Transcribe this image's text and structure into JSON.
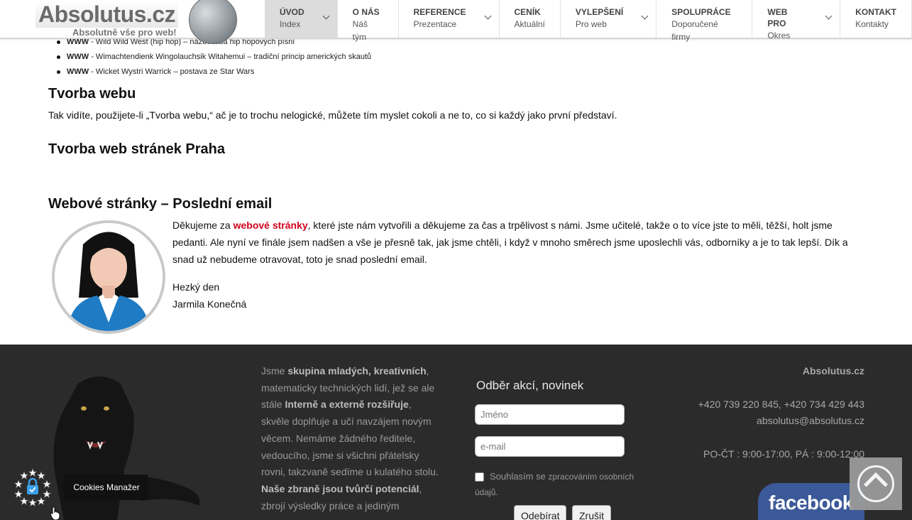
{
  "logo": {
    "name": "Absolutus.cz",
    "tagline": "Absolutně vše pro web!"
  },
  "nav": [
    {
      "title": "ÚVOD",
      "sub": "Index",
      "active": true,
      "dropdown": true
    },
    {
      "title": "O NÁS",
      "sub": "Náš tým",
      "active": false,
      "dropdown": false
    },
    {
      "title": "REFERENCE",
      "sub": "Prezentace",
      "active": false,
      "dropdown": true
    },
    {
      "title": "CENÍK",
      "sub": "Aktuální",
      "active": false,
      "dropdown": false
    },
    {
      "title": "VYLEPŠENÍ",
      "sub": "Pro web",
      "active": false,
      "dropdown": true
    },
    {
      "title": "SPOLUPRÁCE",
      "sub": "Doporučené firmy",
      "active": false,
      "dropdown": false
    },
    {
      "title": "WEB PRO",
      "sub": "Okres",
      "active": false,
      "dropdown": true
    },
    {
      "title": "KONTAKT",
      "sub": "Kontakty",
      "active": false,
      "dropdown": false
    }
  ],
  "bullets": [
    {
      "strong": "WWW",
      "text": " - Wild Wild West (hip hop) – název alba hip hopových písní"
    },
    {
      "strong": "WWW",
      "text": " - Wimachtendienk Wingolauchsik Witahemui – tradiční princip amerických skautů"
    },
    {
      "strong": "WWW",
      "text": " - Wicket Wystri Warrick – postava ze Star Wars"
    }
  ],
  "sections": {
    "tvorba_webu_heading": "Tvorba webu",
    "tvorba_webu_text": "Tak vidíte, použijete-li „Tvorba webu,“ ač je to trochu nelogické, můžete tím myslet cokoli a ne to, co si každý jako první představí.",
    "praha_heading": "Tvorba web stránek Praha",
    "email_heading": "Webové stránky – Poslední email"
  },
  "email": {
    "intro": "Děkujeme za ",
    "link": "webové stránky",
    "body": ", které jste nám vytvořili a děkujeme za čas a trpělivost s námi. Jsme učitelé, takže o to více jste to měli, těžší, holt jsme pedanti. Ale nyní ve finále jsem nadšen a vše je přesně tak, jak jsme chtěli, i když v mnoho směrech jsme uposlechli vás, odborníky a je to tak lepší. Dík a snad už nebudeme otravovat, toto je snad poslední email.",
    "greeting": "Hezký den",
    "signature": "Jarmila Konečná"
  },
  "footer": {
    "about": {
      "p1": "Jsme ",
      "b1": "skupina mladých, kreativních",
      "p2": ", matematicky technických lidí, jež se ale stále ",
      "b2": "Interně a externě rozšiřuje",
      "p3": ", skvěle doplňuje a učí navzájem novým věcem. Nemáme žádného ředitele, vedoucího, jsme si všichni přátelsky rovni, takzvaně sedíme u kulatého stolu. ",
      "b3": "Naše zbraně jsou tvůrčí potenciál",
      "p4": ", zbrojí výsledky práce a jediným"
    },
    "newsletter": {
      "title": "Odběr akcí, novinek",
      "name_placeholder": "Jméno",
      "email_placeholder": "e-mail",
      "consent_main": "Souhlasím se ",
      "consent_small": "zpracováním osobních",
      "consent_tail": "údajů.",
      "subscribe": "Odebírat",
      "cancel": "Zrušit"
    },
    "contact": {
      "brand": "Absolutus.cz",
      "phones": "+420 739 220 845, +420 734 429 443",
      "email": "absolutus@absolutus.cz",
      "hours": "PO-ČT : 9:00-17:00, PÁ : 9:00-12:00"
    },
    "facebook": "facebook"
  },
  "cookies": {
    "label": "Cookies Manažer"
  },
  "colors": {
    "accent_red": "#d0021b",
    "footer_bg": "#2b2b2b",
    "facebook_blue": "#3b5998"
  }
}
